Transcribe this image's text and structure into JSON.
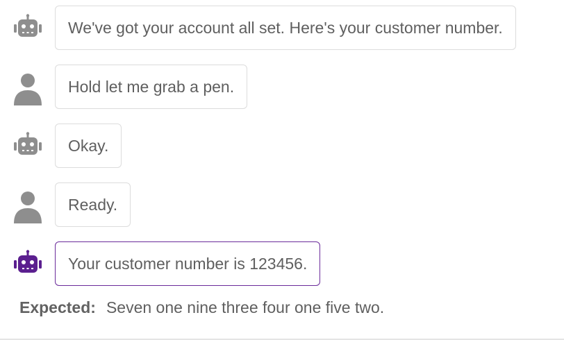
{
  "messages": [
    {
      "role": "bot",
      "icon": "robot-icon",
      "text": "We've got your account all set. Here's your customer number.",
      "highlighted": false
    },
    {
      "role": "user",
      "icon": "user-icon",
      "text": "Hold let me grab a pen.",
      "highlighted": false
    },
    {
      "role": "bot",
      "icon": "robot-icon",
      "text": "Okay.",
      "highlighted": false
    },
    {
      "role": "user",
      "icon": "user-icon",
      "text": "Ready.",
      "highlighted": false
    },
    {
      "role": "bot",
      "icon": "robot-icon",
      "text": "Your customer number is 123456.",
      "highlighted": true
    }
  ],
  "expected": {
    "label": "Expected:",
    "text": "Seven one nine three four one five two."
  },
  "colors": {
    "icon_gray": "#8e8e8e",
    "icon_purple": "#5b1f8f",
    "bubble_border": "#dcdcdc",
    "active_border": "#6a2a9a",
    "text": "#5f5f5f"
  }
}
